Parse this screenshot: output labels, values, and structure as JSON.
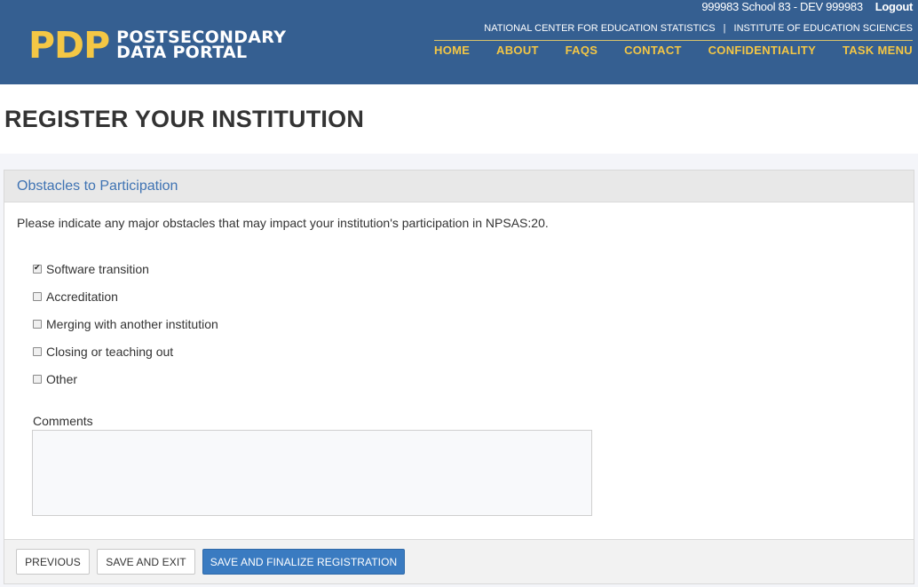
{
  "header": {
    "user_info": "999983 School 83 - DEV  999983",
    "logout": "Logout",
    "logo_mark": "PDP",
    "logo_line1": "POSTSECONDARY",
    "logo_line2": "DATA PORTAL",
    "agency_left": "NATIONAL CENTER FOR EDUCATION STATISTICS",
    "agency_sep": "|",
    "agency_right": "INSTITUTE OF EDUCATION SCIENCES",
    "nav": [
      "HOME",
      "ABOUT",
      "FAQS",
      "CONTACT",
      "CONFIDENTIALITY",
      "TASK MENU"
    ],
    "colors": {
      "header_bg": "#355f91",
      "accent": "#f4c745"
    }
  },
  "page": {
    "title": "REGISTER YOUR INSTITUTION"
  },
  "panel": {
    "heading": "Obstacles to Participation",
    "instruction": "Please indicate any major obstacles that may impact your institution's participation in NPSAS:20.",
    "options": [
      {
        "label": "Software transition",
        "checked": true
      },
      {
        "label": "Accreditation",
        "checked": false
      },
      {
        "label": "Merging with another institution",
        "checked": false
      },
      {
        "label": "Closing or teaching out",
        "checked": false
      },
      {
        "label": "Other",
        "checked": false
      }
    ],
    "comments_label": "Comments",
    "comments_value": ""
  },
  "buttons": {
    "previous": "PREVIOUS",
    "save_exit": "SAVE AND EXIT",
    "finalize": "SAVE AND FINALIZE REGISTRATION",
    "finalize_color": "#3a7bc1"
  }
}
